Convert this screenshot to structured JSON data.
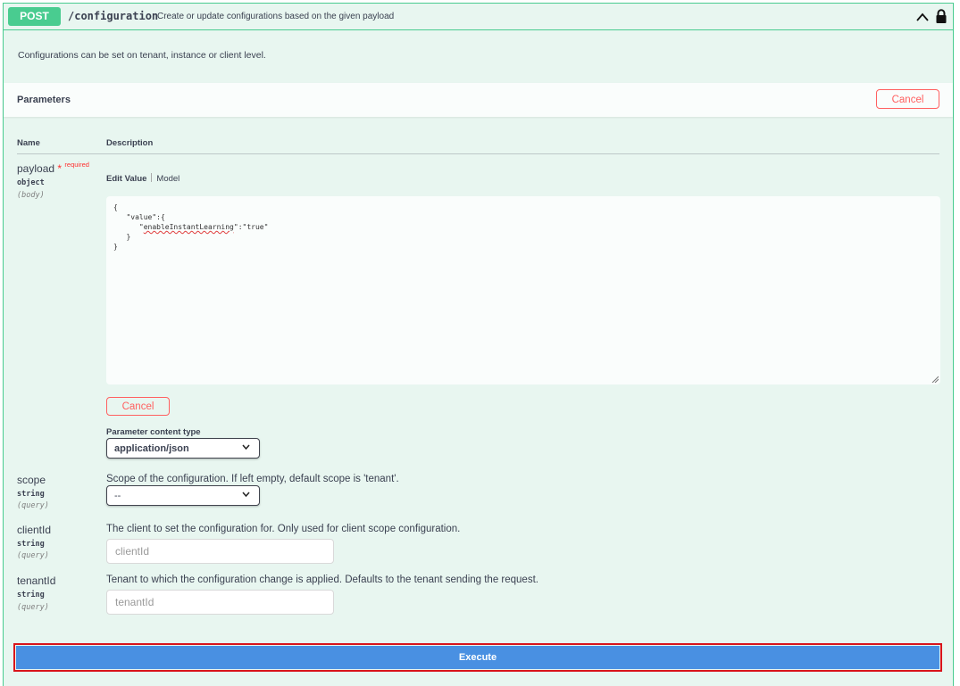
{
  "operation": {
    "method": "POST",
    "path": "/configuration",
    "summary": "Create or update configurations based on the given payload",
    "description": "Configurations can be set on tenant, instance or client level."
  },
  "parameters": {
    "title": "Parameters",
    "cancel_label": "Cancel",
    "col_name": "Name",
    "col_description": "Description"
  },
  "payload": {
    "name": "payload",
    "required_star": "*",
    "required_label": "required",
    "type": "object",
    "in": "(body)",
    "tab_edit_value": "Edit Value",
    "tab_model": "Model",
    "body_lines": [
      "{",
      "   \"value\":{",
      "      \"",
      "\":\"true\"",
      "   }",
      "}"
    ],
    "body_key": "enableInstantLearning",
    "cancel_label": "Cancel",
    "content_type_label": "Parameter content type",
    "content_type_value": "application/json"
  },
  "scope": {
    "name": "scope",
    "type": "string",
    "in": "(query)",
    "description": "Scope of the configuration. If left empty, default scope is 'tenant'.",
    "selected": "--"
  },
  "clientId": {
    "name": "clientId",
    "type": "string",
    "in": "(query)",
    "description": "The client to set the configuration for. Only used for client scope configuration.",
    "placeholder": "clientId"
  },
  "tenantId": {
    "name": "tenantId",
    "type": "string",
    "in": "(query)",
    "description": "Tenant to which the configuration change is applied. Defaults to the tenant sending the request.",
    "placeholder": "tenantId"
  },
  "execute_label": "Execute",
  "colors": {
    "post_green": "#49cc90",
    "block_bg": "#e8f6f0",
    "cancel_red": "#ff6060",
    "execute_blue": "#4990e2",
    "highlight_red": "#d9141b"
  }
}
